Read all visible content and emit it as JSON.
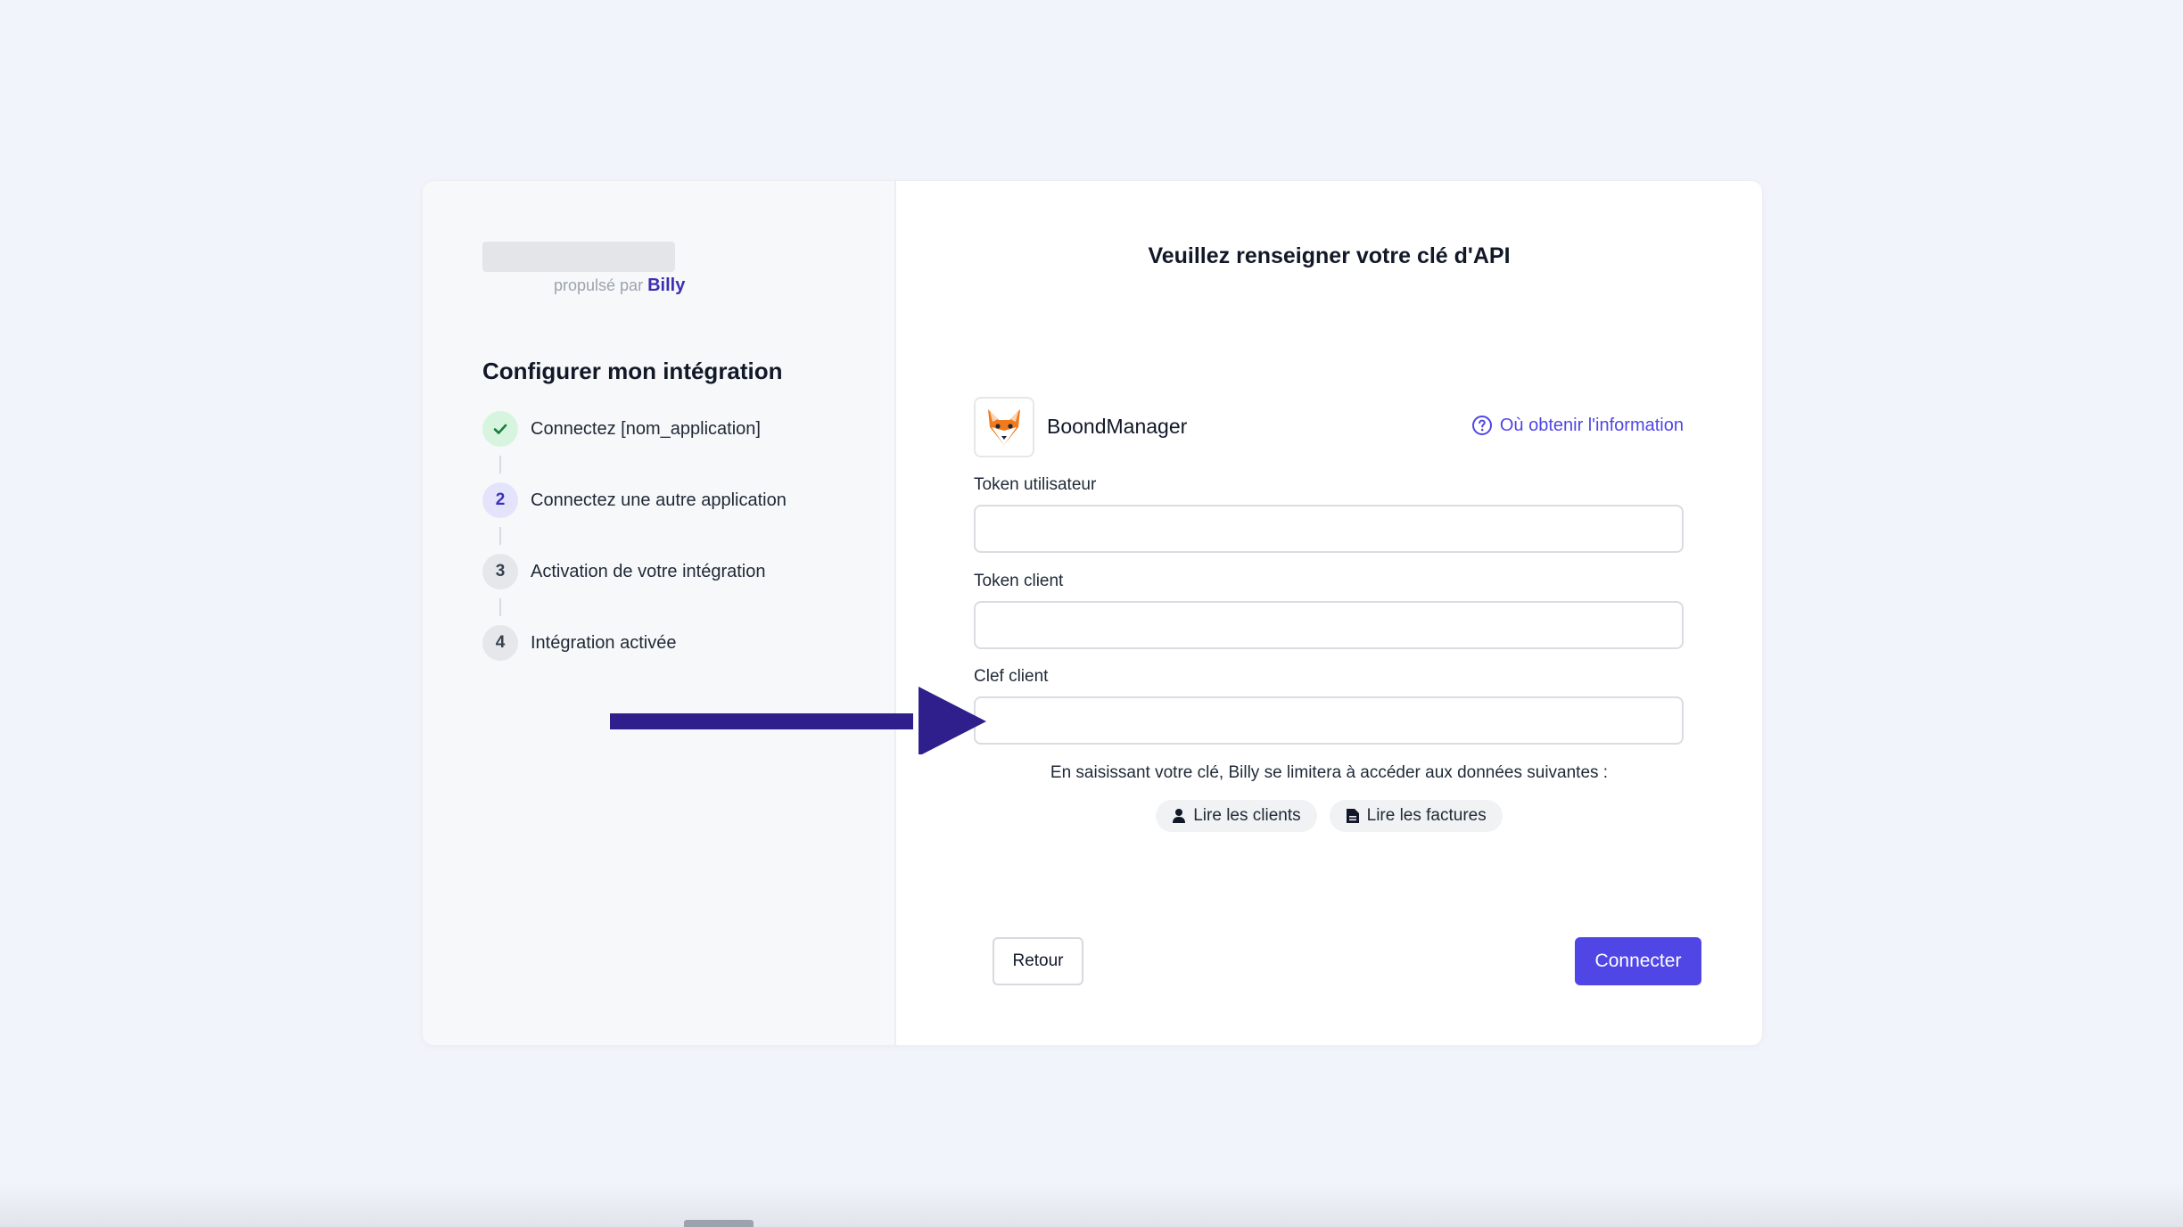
{
  "branding": {
    "powered_prefix": "propulsé par",
    "powered_brand": "Billy"
  },
  "sidebar": {
    "title": "Configurer mon intégration",
    "steps": [
      {
        "marker": "✓",
        "label": "Connectez [nom_application]",
        "state": "done"
      },
      {
        "marker": "2",
        "label": "Connectez une autre application",
        "state": "active"
      },
      {
        "marker": "3",
        "label": "Activation de votre intégration",
        "state": "todo"
      },
      {
        "marker": "4",
        "label": "Intégration activée",
        "state": "todo"
      }
    ]
  },
  "main": {
    "title": "Veuillez renseigner votre clé d'API",
    "app": {
      "name": "BoondManager",
      "logo_icon": "fox-icon",
      "help_link": "Où obtenir l'information"
    },
    "fields": [
      {
        "label": "Token utilisateur",
        "value": "",
        "placeholder": ""
      },
      {
        "label": "Token client",
        "value": "",
        "placeholder": ""
      },
      {
        "label": "Clef client",
        "value": "",
        "placeholder": ""
      }
    ],
    "consent_text": "En saisissant votre clé, Billy se limitera à accéder aux données suivantes :",
    "permissions": [
      {
        "icon": "user-icon",
        "label": "Lire les clients"
      },
      {
        "icon": "document-icon",
        "label": "Lire les factures"
      }
    ],
    "back_label": "Retour",
    "connect_label": "Connecter"
  },
  "colors": {
    "accent": "#4f46e5",
    "arrow": "#2e1f8c",
    "background": "#f1f4fa",
    "done_green": "#d7f5de"
  }
}
